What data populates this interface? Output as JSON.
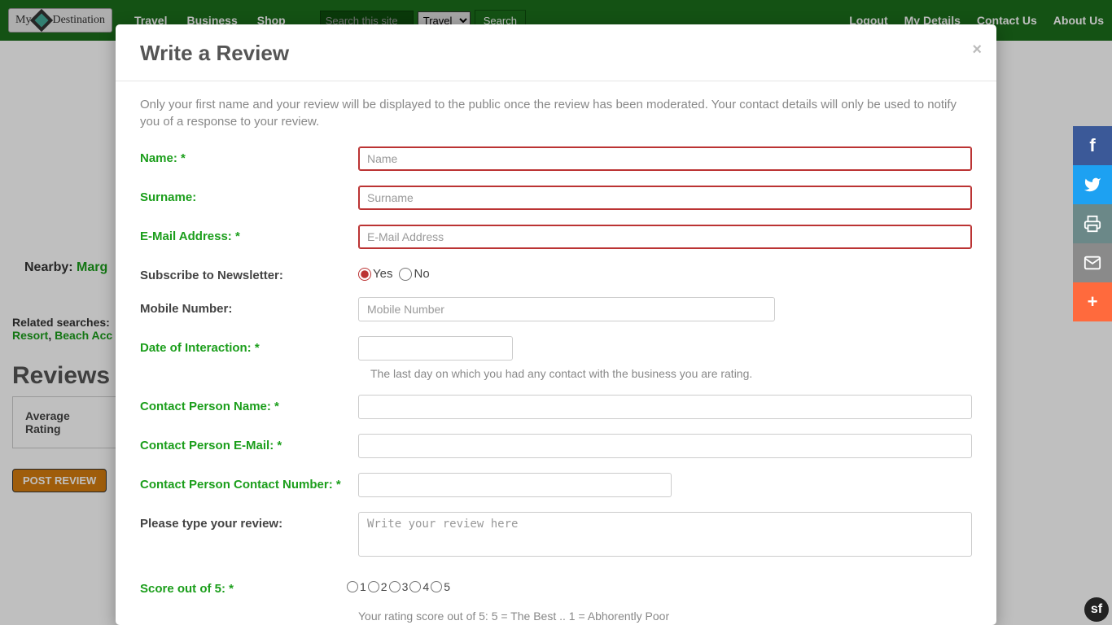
{
  "topbar": {
    "logo_pre": "My",
    "logo_post": "Destination",
    "nav": [
      "Travel",
      "Business",
      "Shop"
    ],
    "search_placeholder": "Search this site",
    "search_select": "Travel",
    "search_btn": "Search",
    "right": [
      "Logout",
      "My Details",
      "Contact Us",
      "About Us"
    ]
  },
  "page": {
    "nearby_label": "Nearby:",
    "nearby_value": "Marg",
    "related_label": "Related searches:",
    "related_links": [
      "Resort",
      "Beach Acc"
    ],
    "reviews_heading": "Reviews",
    "avg_label": "Average Rating",
    "post_btn": "POST REVIEW"
  },
  "modal": {
    "title": "Write a Review",
    "intro": "Only your first name and your review will be displayed to the public once the review has been moderated. Your contact details will only be used to notify you of a response to your review.",
    "name_label": "Name: *",
    "name_ph": "Name",
    "surname_label": "Surname:",
    "surname_ph": "Surname",
    "email_label": "E-Mail Address: *",
    "email_ph": "E-Mail Address",
    "newsletter_label": "Subscribe to Newsletter:",
    "yes": "Yes",
    "no": "No",
    "mobile_label": "Mobile Number:",
    "mobile_ph": "Mobile Number",
    "date_label": "Date of Interaction: *",
    "date_help": "The last day on which you had any contact with the business you are rating.",
    "cpn_label": "Contact Person Name: *",
    "cpe_label": "Contact Person E-Mail: *",
    "cpcn_label": "Contact Person Contact Number: *",
    "review_label": "Please type your review:",
    "review_ph": "Write your review here",
    "score_label": "Score out of 5: *",
    "score_opts": [
      "1",
      "2",
      "3",
      "4",
      "5"
    ],
    "score_help": "Your rating score out of 5: 5 = The Best .. 1 = Abhorently Poor"
  },
  "sidebar": {
    "items": [
      "f",
      "t",
      "print",
      "mail",
      "+"
    ]
  }
}
